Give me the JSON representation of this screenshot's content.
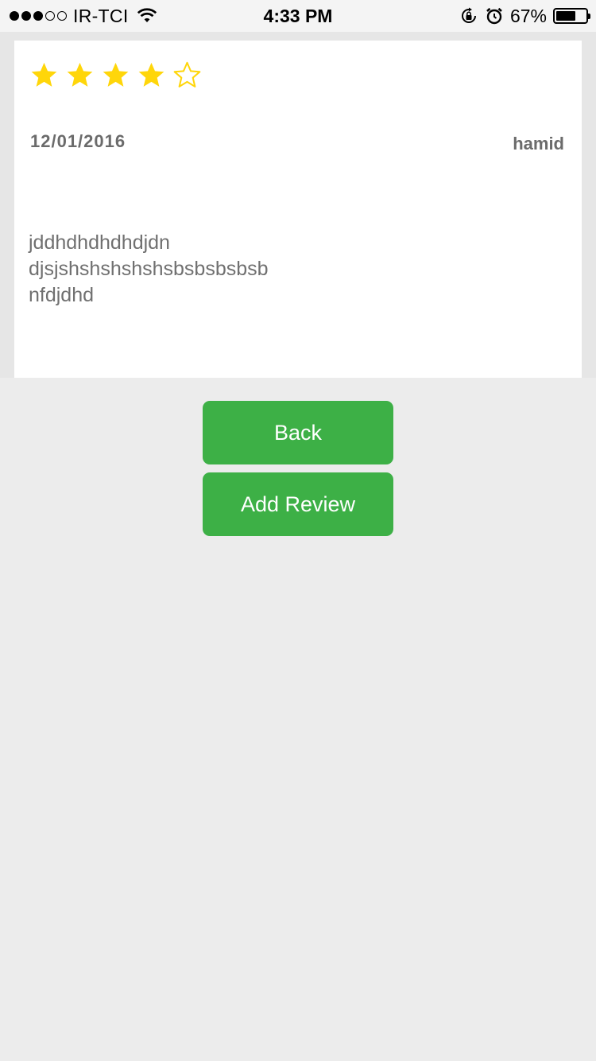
{
  "status_bar": {
    "carrier": "IR-TCI",
    "time": "4:33 PM",
    "battery_percent": "67%",
    "battery_level": 0.67,
    "signal_bars_filled": 3,
    "signal_bars_total": 5
  },
  "review": {
    "rating": 4,
    "max_rating": 5,
    "date": "12/01/2016",
    "author": "hamid",
    "text_lines": [
      "jddhdhdhdhdjdn",
      "djsjshshshshshsbsbsbsbsb",
      "nfdjdhd"
    ]
  },
  "actions": {
    "back_label": "Back",
    "add_review_label": "Add Review"
  },
  "colors": {
    "star": "#ffd60a",
    "button": "#3db046",
    "text_muted": "#6b6b6b",
    "background": "#ececec"
  }
}
